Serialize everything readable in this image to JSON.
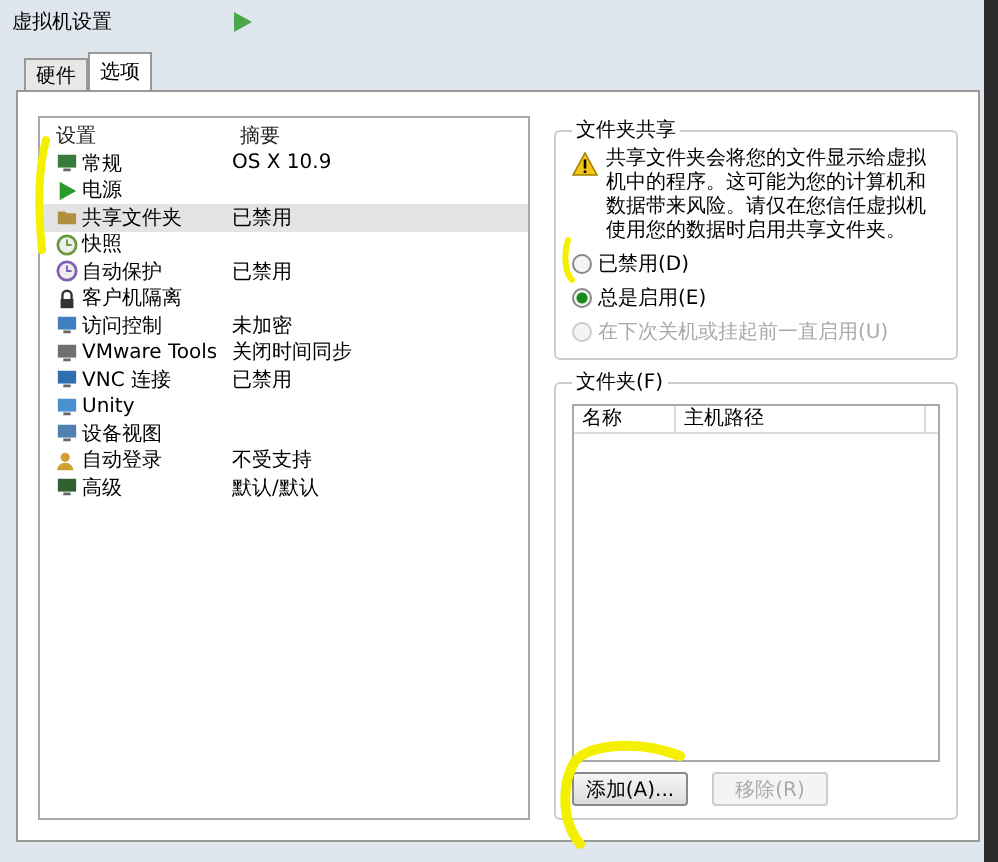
{
  "window": {
    "title": "虚拟机设置"
  },
  "tabs": [
    {
      "label": "硬件",
      "selected": false
    },
    {
      "label": "选项",
      "selected": true
    }
  ],
  "settings_list": {
    "columns": [
      "设置",
      "摘要"
    ],
    "rows": [
      {
        "kind": "general",
        "name": "常规",
        "summary": "OS X 10.9",
        "selected": false
      },
      {
        "kind": "power",
        "name": "电源",
        "selected": false
      },
      {
        "kind": "shared",
        "name": "共享文件夹",
        "summary": "已禁用",
        "selected": true
      },
      {
        "kind": "snapshot",
        "name": "快照",
        "selected": false
      },
      {
        "kind": "autoprotect",
        "name": "自动保护",
        "summary": "已禁用",
        "selected": false
      },
      {
        "kind": "isolation",
        "name": "客户机隔离",
        "selected": false
      },
      {
        "kind": "access",
        "name": "访问控制",
        "summary": "未加密",
        "selected": false
      },
      {
        "kind": "tools",
        "name": "VMware Tools",
        "summary": "关闭时间同步",
        "selected": false
      },
      {
        "kind": "vnc",
        "name": "VNC 连接",
        "summary": "已禁用",
        "selected": false
      },
      {
        "kind": "unity",
        "name": "Unity",
        "selected": false
      },
      {
        "kind": "appliance",
        "name": "设备视图",
        "selected": false
      },
      {
        "kind": "autologin",
        "name": "自动登录",
        "summary": "不受支持",
        "selected": false
      },
      {
        "kind": "advanced",
        "name": "高级",
        "summary": "默认/默认",
        "selected": false
      }
    ]
  },
  "folder_sharing": {
    "title": "文件夹共享",
    "warning": "共享文件夹会将您的文件显示给虚拟机中的程序。这可能为您的计算机和数据带来风险。请仅在您信任虚拟机使用您的数据时启用共享文件夹。",
    "options": [
      {
        "label": "已禁用(D)",
        "selected": false,
        "disabled": false
      },
      {
        "label": "总是启用(E)",
        "selected": true,
        "disabled": false
      },
      {
        "label": "在下次关机或挂起前一直启用(U)",
        "selected": false,
        "disabled": true
      }
    ]
  },
  "folders": {
    "title": "文件夹(F)",
    "columns": [
      "名称",
      "主机路径"
    ],
    "buttons": [
      {
        "label": "添加(A)...",
        "disabled": false
      },
      {
        "label": "移除(R)",
        "disabled": true
      }
    ]
  }
}
